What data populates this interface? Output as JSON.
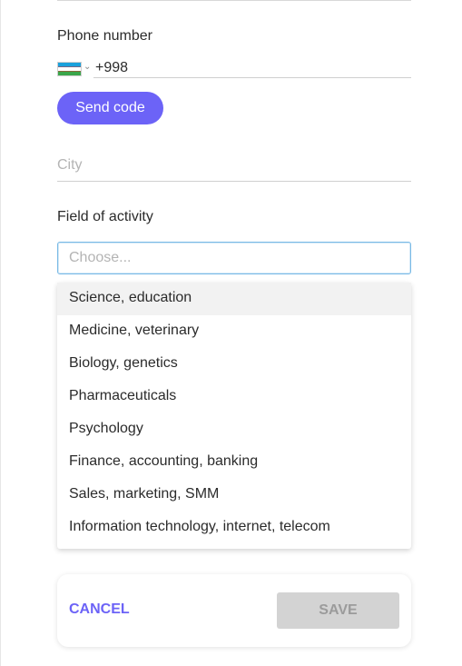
{
  "form": {
    "phone": {
      "label": "Phone number",
      "flag_icon": "uzbekistan-flag-icon",
      "value": "+998",
      "send_code_label": "Send code"
    },
    "city": {
      "placeholder": "City"
    },
    "field_of_activity": {
      "label": "Field of activity",
      "placeholder": "Choose...",
      "options": [
        "Science, education",
        "Medicine, veterinary",
        "Biology, genetics",
        "Pharmaceuticals",
        "Psychology",
        "Finance, accounting, banking",
        "Sales, marketing, SMM",
        "Information technology, internet, telecom"
      ],
      "highlighted_index": 0
    }
  },
  "footer": {
    "cancel_label": "CANCEL",
    "save_label": "SAVE"
  },
  "colors": {
    "accent": "#6c63f7",
    "focus_border": "#79b9e6",
    "disabled_bg": "#d3d3d3"
  }
}
